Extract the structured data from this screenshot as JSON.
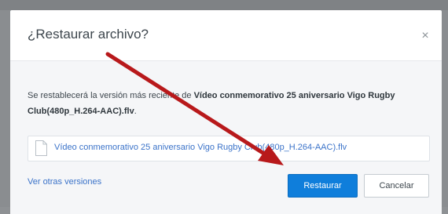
{
  "dialog": {
    "title": "¿Restaurar archivo?",
    "close_glyph": "×",
    "message_prefix": "Se restablecerá la versión más reciente de ",
    "message_file": "Vídeo conmemorativo 25 aniversario Vigo Rugby Club(480p_H.264-AAC).flv",
    "message_suffix": ".",
    "file_name": "Vídeo conmemorativo 25 aniversario Vigo Rugby Club(480p_H.264-AAC).flv",
    "other_versions_label": "Ver otras versiones",
    "restore_label": "Restaurar",
    "cancel_label": "Cancelar"
  },
  "icons": {
    "close": "close-icon",
    "file": "file-icon",
    "annotation": "arrow-annotation"
  },
  "colors": {
    "primary": "#0f7edb",
    "link": "#3b73c9",
    "annotation_arrow": "#b8191b",
    "overlay": "#8e9194"
  }
}
